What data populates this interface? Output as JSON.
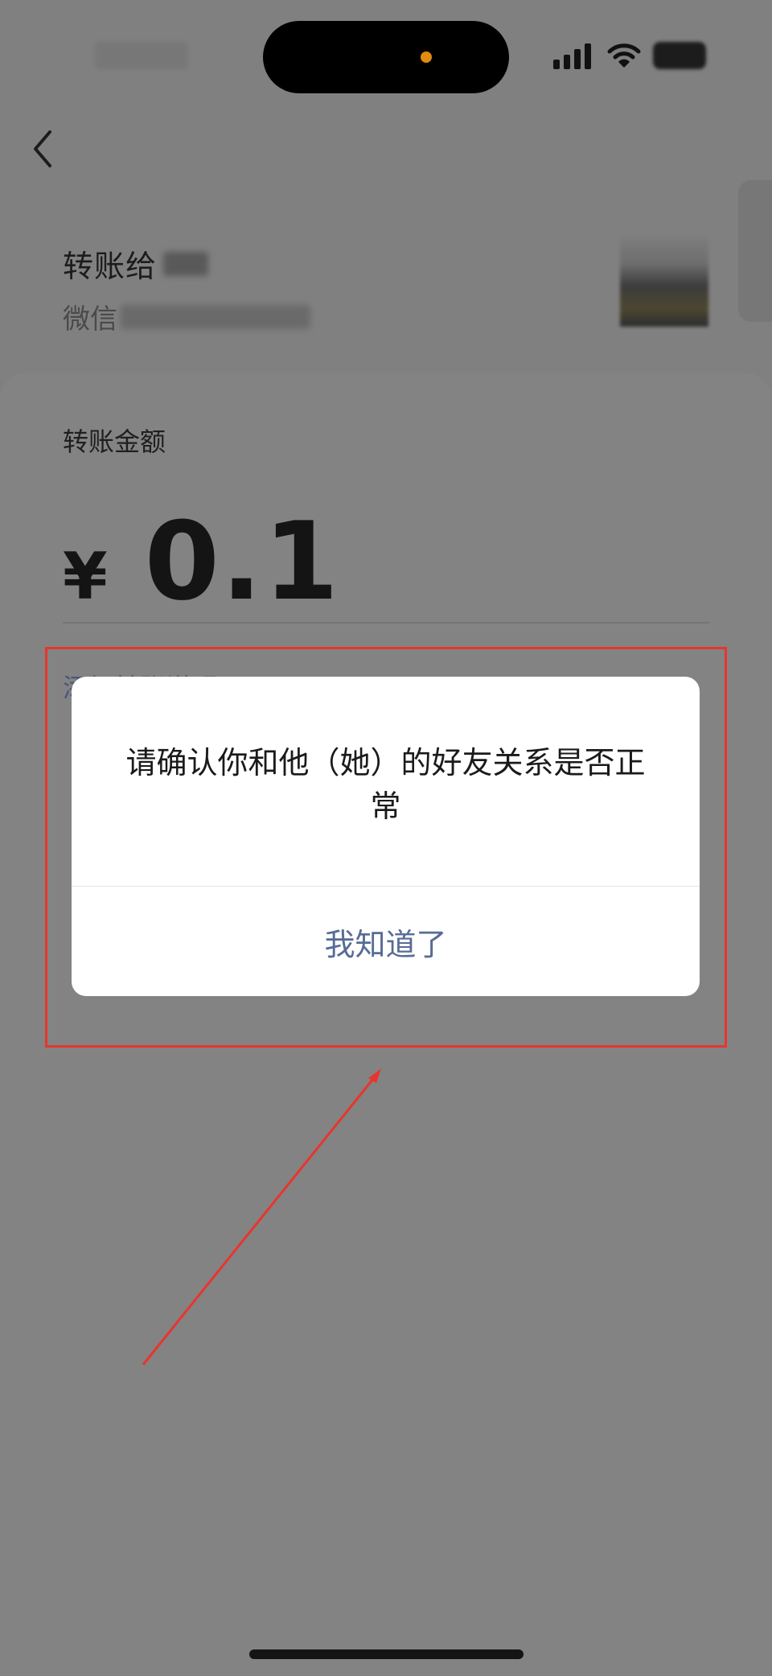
{
  "payee": {
    "title": "转账给",
    "wechat_label": "微信"
  },
  "amount": {
    "label": "转账金额",
    "currency_symbol": "¥",
    "value": "0.1",
    "note_link": "添加转账说明"
  },
  "dialog": {
    "message": "请确认你和他（她）的好友关系是否正常",
    "confirm_label": "我知道了"
  },
  "colors": {
    "overlay": "#808080",
    "link_blue": "#576b95",
    "annotation_red": "#e8352d",
    "status_dot": "#e08a10"
  },
  "icons": [
    "back-chevron-icon",
    "cellular-signal-icon",
    "wifi-icon",
    "battery-icon"
  ]
}
